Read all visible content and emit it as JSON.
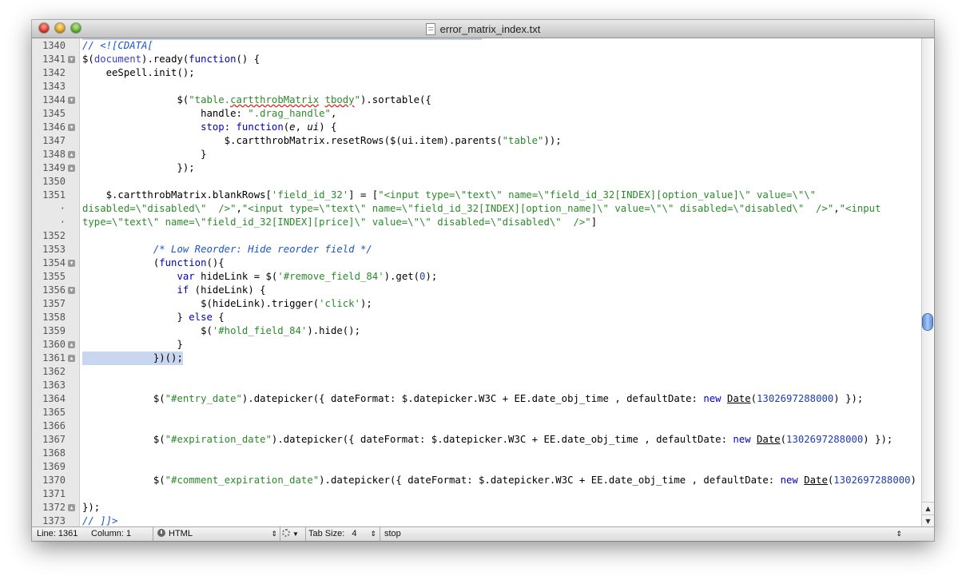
{
  "window": {
    "title": "error_matrix_index.txt"
  },
  "editor": {
    "lines": [
      {
        "n": "1340",
        "fold": "",
        "segs": [
          {
            "t": "// <![CDATA[",
            "c": "t-com"
          }
        ]
      },
      {
        "n": "1341",
        "fold": "open",
        "segs": [
          {
            "t": "$(",
            "c": ""
          },
          {
            "t": "document",
            "c": "t-sel"
          },
          {
            "t": ").ready(",
            "c": ""
          },
          {
            "t": "function",
            "c": "t-key"
          },
          {
            "t": "() {",
            "c": ""
          }
        ]
      },
      {
        "n": "1342",
        "fold": "",
        "segs": [
          {
            "t": "    eeSpell.init();",
            "c": ""
          }
        ]
      },
      {
        "n": "1343",
        "fold": "",
        "segs": []
      },
      {
        "n": "1344",
        "fold": "open",
        "segs": [
          {
            "t": "                $(",
            "c": ""
          },
          {
            "t": "\"table.",
            "c": "t-str"
          },
          {
            "t": "cartthrobMatrix",
            "c": "t-str t-spell"
          },
          {
            "t": " ",
            "c": "t-str"
          },
          {
            "t": "tbody",
            "c": "t-str t-spell"
          },
          {
            "t": "\"",
            "c": "t-str"
          },
          {
            "t": ").sortable({",
            "c": ""
          }
        ]
      },
      {
        "n": "1345",
        "fold": "",
        "segs": [
          {
            "t": "                    handle: ",
            "c": ""
          },
          {
            "t": "\".drag_handle\"",
            "c": "t-str"
          },
          {
            "t": ",",
            "c": ""
          }
        ]
      },
      {
        "n": "1346",
        "fold": "open",
        "segs": [
          {
            "t": "                    ",
            "c": ""
          },
          {
            "t": "stop",
            "c": "t-key"
          },
          {
            "t": ": ",
            "c": ""
          },
          {
            "t": "function",
            "c": "t-key"
          },
          {
            "t": "(",
            "c": ""
          },
          {
            "t": "e",
            "c": "t-arg"
          },
          {
            "t": ", ",
            "c": ""
          },
          {
            "t": "ui",
            "c": "t-arg"
          },
          {
            "t": ") {",
            "c": ""
          }
        ]
      },
      {
        "n": "1347",
        "fold": "",
        "segs": [
          {
            "t": "                        $.cartthrobMatrix.resetRows($(ui.item).parents(",
            "c": ""
          },
          {
            "t": "\"table\"",
            "c": "t-str"
          },
          {
            "t": "));",
            "c": ""
          }
        ]
      },
      {
        "n": "1348",
        "fold": "close",
        "segs": [
          {
            "t": "                    }",
            "c": ""
          }
        ]
      },
      {
        "n": "1349",
        "fold": "close",
        "segs": [
          {
            "t": "                });",
            "c": ""
          }
        ]
      },
      {
        "n": "1350",
        "fold": "",
        "segs": []
      },
      {
        "n": "1351",
        "fold": "",
        "segs": [
          {
            "t": "    $.cartthrobMatrix.blankRows[",
            "c": ""
          },
          {
            "t": "'field_id_32'",
            "c": "t-str"
          },
          {
            "t": "] = [",
            "c": ""
          },
          {
            "t": "\"<input type=\\\"text\\\" name=\\\"field_id_32[INDEX][option_value]\\\" value=\\\"\\\"",
            "c": "t-str"
          }
        ]
      },
      {
        "n": "·",
        "fold": "",
        "segs": [
          {
            "t": "disabled=\\\"disabled\\\"  />\"",
            "c": "t-str"
          },
          {
            "t": ",",
            "c": ""
          },
          {
            "t": "\"<input type=\\\"text\\\" name=\\\"field_id_32[INDEX][option_name]\\\" value=\\\"\\\" disabled=\\\"disabled\\\"  />\"",
            "c": "t-str"
          },
          {
            "t": ",",
            "c": ""
          },
          {
            "t": "\"<input",
            "c": "t-str"
          }
        ]
      },
      {
        "n": "·",
        "fold": "",
        "segs": [
          {
            "t": "type=\\\"text\\\" name=\\\"field_id_32[INDEX][price]\\\" value=\\\"\\\" disabled=\\\"disabled\\\"  />\"",
            "c": "t-str"
          },
          {
            "t": "]",
            "c": ""
          }
        ]
      },
      {
        "n": "1352",
        "fold": "",
        "segs": []
      },
      {
        "n": "1353",
        "fold": "",
        "segs": [
          {
            "t": "            /* Low Reorder: Hide reorder field */",
            "c": "t-com"
          }
        ]
      },
      {
        "n": "1354",
        "fold": "open",
        "segs": [
          {
            "t": "            (",
            "c": ""
          },
          {
            "t": "function",
            "c": "t-key"
          },
          {
            "t": "(){",
            "c": ""
          }
        ]
      },
      {
        "n": "1355",
        "fold": "",
        "segs": [
          {
            "t": "                ",
            "c": ""
          },
          {
            "t": "var",
            "c": "t-key"
          },
          {
            "t": " hideLink = $(",
            "c": ""
          },
          {
            "t": "'#remove_field_84'",
            "c": "t-str"
          },
          {
            "t": ").get(",
            "c": ""
          },
          {
            "t": "0",
            "c": "t-num"
          },
          {
            "t": ");",
            "c": ""
          }
        ]
      },
      {
        "n": "1356",
        "fold": "open",
        "segs": [
          {
            "t": "                ",
            "c": ""
          },
          {
            "t": "if",
            "c": "t-key"
          },
          {
            "t": " (hideLink) {",
            "c": ""
          }
        ]
      },
      {
        "n": "1357",
        "fold": "",
        "segs": [
          {
            "t": "                    $(hideLink).trigger(",
            "c": ""
          },
          {
            "t": "'click'",
            "c": "t-str"
          },
          {
            "t": ");",
            "c": ""
          }
        ]
      },
      {
        "n": "1358",
        "fold": "",
        "segs": [
          {
            "t": "                } ",
            "c": ""
          },
          {
            "t": "else",
            "c": "t-key"
          },
          {
            "t": " {",
            "c": ""
          }
        ]
      },
      {
        "n": "1359",
        "fold": "",
        "segs": [
          {
            "t": "                    $(",
            "c": ""
          },
          {
            "t": "'#hold_field_84'",
            "c": "t-str"
          },
          {
            "t": ").hide();",
            "c": ""
          }
        ]
      },
      {
        "n": "1360",
        "fold": "close",
        "segs": [
          {
            "t": "                }",
            "c": ""
          }
        ]
      },
      {
        "n": "1361",
        "fold": "close",
        "hl": true,
        "segs": [
          {
            "t": "            })();",
            "c": ""
          }
        ]
      },
      {
        "n": "1362",
        "fold": "",
        "segs": []
      },
      {
        "n": "1363",
        "fold": "",
        "segs": []
      },
      {
        "n": "1364",
        "fold": "",
        "segs": [
          {
            "t": "            $(",
            "c": ""
          },
          {
            "t": "\"#entry_date\"",
            "c": "t-str"
          },
          {
            "t": ").datepicker({ dateFormat: $.datepicker.W3C + EE.date_obj_time , defaultDate: ",
            "c": ""
          },
          {
            "t": "new",
            "c": "t-key"
          },
          {
            "t": " ",
            "c": ""
          },
          {
            "t": "Date",
            "c": "t-cls"
          },
          {
            "t": "(",
            "c": ""
          },
          {
            "t": "1302697288000",
            "c": "t-num"
          },
          {
            "t": ") });",
            "c": ""
          }
        ]
      },
      {
        "n": "1365",
        "fold": "",
        "segs": []
      },
      {
        "n": "1366",
        "fold": "",
        "segs": []
      },
      {
        "n": "1367",
        "fold": "",
        "segs": [
          {
            "t": "            $(",
            "c": ""
          },
          {
            "t": "\"#expiration_date\"",
            "c": "t-str"
          },
          {
            "t": ").datepicker({ dateFormat: $.datepicker.W3C + EE.date_obj_time , defaultDate: ",
            "c": ""
          },
          {
            "t": "new",
            "c": "t-key"
          },
          {
            "t": " ",
            "c": ""
          },
          {
            "t": "Date",
            "c": "t-cls"
          },
          {
            "t": "(",
            "c": ""
          },
          {
            "t": "1302697288000",
            "c": "t-num"
          },
          {
            "t": ") });",
            "c": ""
          }
        ]
      },
      {
        "n": "1368",
        "fold": "",
        "segs": []
      },
      {
        "n": "1369",
        "fold": "",
        "segs": []
      },
      {
        "n": "1370",
        "fold": "",
        "segs": [
          {
            "t": "            $(",
            "c": ""
          },
          {
            "t": "\"#comment_expiration_date\"",
            "c": "t-str"
          },
          {
            "t": ").datepicker({ dateFormat: $.datepicker.W3C + EE.date_obj_time , defaultDate: ",
            "c": ""
          },
          {
            "t": "new",
            "c": "t-key"
          },
          {
            "t": " ",
            "c": ""
          },
          {
            "t": "Date",
            "c": "t-cls"
          },
          {
            "t": "(",
            "c": ""
          },
          {
            "t": "1302697288000",
            "c": "t-num"
          },
          {
            "t": ") });",
            "c": ""
          }
        ]
      },
      {
        "n": "1371",
        "fold": "",
        "segs": []
      },
      {
        "n": "1372",
        "fold": "close",
        "segs": [
          {
            "t": "});",
            "c": ""
          }
        ]
      },
      {
        "n": "1373",
        "fold": "",
        "segs": [
          {
            "t": "// ]]>",
            "c": "t-com"
          }
        ]
      }
    ]
  },
  "statusbar": {
    "line_label": "Line:",
    "line_value": "1361",
    "column_label": "Column:",
    "column_value": "1",
    "language": "HTML",
    "tab_size_label": "Tab Size:",
    "tab_size_value": "4",
    "symbol": "stop"
  }
}
